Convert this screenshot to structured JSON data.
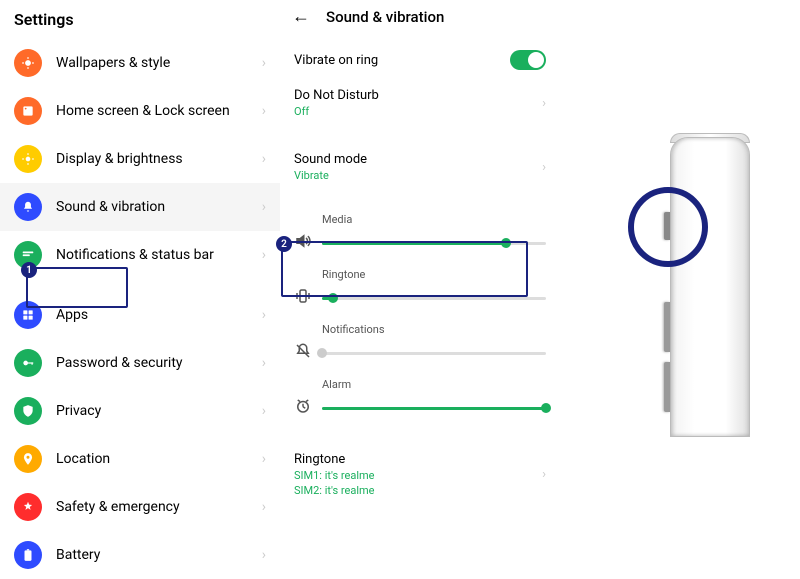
{
  "settings": {
    "title": "Settings",
    "items": [
      {
        "label": "Wallpapers & style",
        "color": "#ff6a29"
      },
      {
        "label": "Home screen & Lock screen",
        "color": "#ff6a29"
      },
      {
        "label": "Display & brightness",
        "color": "#ffcc00"
      },
      {
        "label": "Sound & vibration",
        "color": "#2e4bff"
      },
      {
        "label": "Notifications & status bar",
        "color": "#1aaf5d"
      },
      {
        "label": "Apps",
        "color": "#2e4bff"
      },
      {
        "label": "Password & security",
        "color": "#1aaf5d"
      },
      {
        "label": "Privacy",
        "color": "#1aaf5d"
      },
      {
        "label": "Location",
        "color": "#ffaa00"
      },
      {
        "label": "Safety & emergency",
        "color": "#ff2d2d"
      },
      {
        "label": "Battery",
        "color": "#2e4bff"
      }
    ]
  },
  "sound": {
    "header": "Sound & vibration",
    "vibrate_on_ring": "Vibrate on ring",
    "dnd_label": "Do Not Disturb",
    "dnd_value": "Off",
    "sound_mode_label": "Sound mode",
    "sound_mode_value": "Vibrate",
    "sliders": {
      "media": {
        "label": "Media",
        "value": 82
      },
      "ringtone": {
        "label": "Ringtone",
        "value": 5
      },
      "notifications": {
        "label": "Notifications",
        "value": 0
      },
      "alarm": {
        "label": "Alarm",
        "value": 100
      }
    },
    "ringtone_row": {
      "label": "Ringtone",
      "sim1": "SIM1: it's realme",
      "sim2": "SIM2: it's realme"
    }
  },
  "annotations": {
    "one": "1",
    "two": "2"
  }
}
